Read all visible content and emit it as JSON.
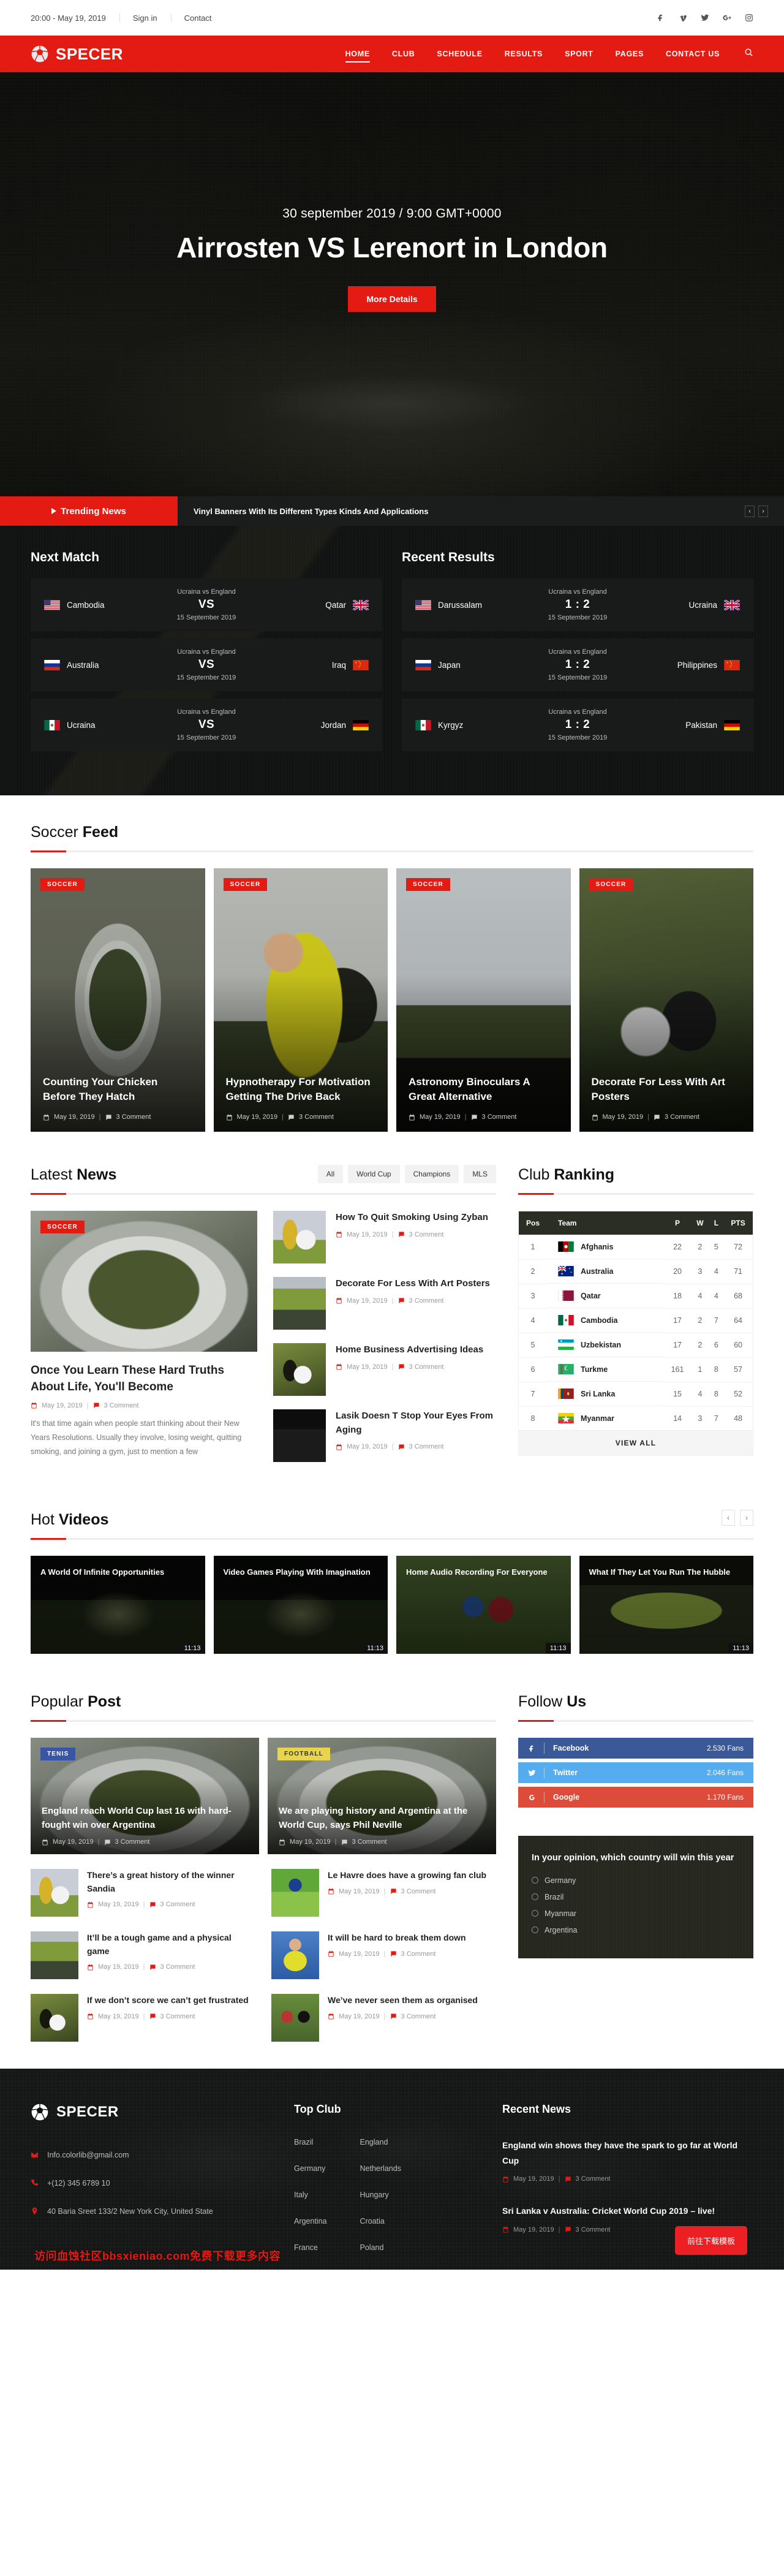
{
  "topbar": {
    "datetime": "20:00 - May 19, 2019",
    "signin": "Sign in",
    "contact": "Contact",
    "socials": [
      "facebook-icon",
      "vimeo-icon",
      "twitter-icon",
      "google-plus-icon",
      "instagram-icon"
    ]
  },
  "nav": {
    "brand": "SPECER",
    "items": [
      {
        "label": "HOME",
        "active": true
      },
      {
        "label": "CLUB",
        "active": false
      },
      {
        "label": "SCHEDULE",
        "active": false
      },
      {
        "label": "RESULTS",
        "active": false
      },
      {
        "label": "SPORT",
        "active": false
      },
      {
        "label": "PAGES",
        "active": false
      },
      {
        "label": "CONTACT US",
        "active": false
      }
    ],
    "search_icon": "search-icon"
  },
  "hero": {
    "date": "30 september 2019 / 9:00 GMT+0000",
    "title": "Airrosten VS Lerenort in London",
    "button": "More Details"
  },
  "trending": {
    "label": "Trending News",
    "headline": "Vinyl Banners With Its Different Types Kinds And Applications",
    "prev": "‹",
    "next": "›"
  },
  "next_match": {
    "title": "Next Match",
    "matches": [
      {
        "home": "Cambodia",
        "away": "Qatar",
        "sub": "Ucraina vs England",
        "score": "VS",
        "date": "15 September 2019",
        "home_flag": "usa",
        "away_flag": "uk"
      },
      {
        "home": "Australia",
        "away": "Iraq",
        "sub": "Ucraina vs England",
        "score": "VS",
        "date": "15 September 2019",
        "home_flag": "russia",
        "away_flag": "china"
      },
      {
        "home": "Ucraina",
        "away": "Jordan",
        "sub": "Ucraina vs England",
        "score": "VS",
        "date": "15 September 2019",
        "home_flag": "mexico",
        "away_flag": "germany"
      }
    ]
  },
  "recent_results": {
    "title": "Recent Results",
    "matches": [
      {
        "home": "Darussalam",
        "away": "Ucraina",
        "sub": "Ucraina vs England",
        "score": "1 : 2",
        "date": "15 September 2019",
        "home_flag": "usa",
        "away_flag": "uk"
      },
      {
        "home": "Japan",
        "away": "Philippines",
        "sub": "Ucraina vs England",
        "score": "1 : 2",
        "date": "15 September 2019",
        "home_flag": "russia",
        "away_flag": "china"
      },
      {
        "home": "Kyrgyz",
        "away": "Pakistan",
        "sub": "Ucraina vs England",
        "score": "1 : 2",
        "date": "15 September 2019",
        "home_flag": "mexico",
        "away_flag": "germany"
      }
    ]
  },
  "soccer_feed": {
    "title_light": "Soccer ",
    "title_bold": "Feed",
    "cards": [
      {
        "category": "SOCCER",
        "title": "Counting Your Chicken Before They Hatch",
        "date": "May 19, 2019",
        "comments": "3 Comment",
        "img": "ph-stadium-aerial"
      },
      {
        "category": "SOCCER",
        "title": "Hypnotherapy For Motivation Getting The Drive Back",
        "date": "May 19, 2019",
        "comments": "3 Comment",
        "img": "ph-keeper"
      },
      {
        "category": "SOCCER",
        "title": "Astronomy Binoculars A Great Alternative",
        "date": "May 19, 2019",
        "comments": "3 Comment",
        "img": "ph-roof"
      },
      {
        "category": "SOCCER",
        "title": "Decorate For Less With Art Posters",
        "date": "May 19, 2019",
        "comments": "3 Comment",
        "img": "ph-boot"
      }
    ]
  },
  "latest_news": {
    "title_light": "Latest ",
    "title_bold": "News",
    "filters": [
      "All",
      "World Cup",
      "Champions",
      "MLS"
    ],
    "feature": {
      "category": "SOCCER",
      "title": "Once You Learn These Hard Truths About Life, You'll Become",
      "date": "May 19, 2019",
      "comments": "3 Comment",
      "excerpt": "It's that time again when people start thinking about their New Years Resolutions. Usually they involve, losing weight, quitting smoking, and joining a gym, just to mention a few",
      "img": "ph-archstadium"
    },
    "items": [
      {
        "title": "How To Quit Smoking Using Zyban",
        "date": "May 19, 2019",
        "comments": "3 Comment",
        "img": "ph-trophy"
      },
      {
        "title": "Decorate For Less With Art Posters",
        "date": "May 19, 2019",
        "comments": "3 Comment",
        "img": "ph-bigstad"
      },
      {
        "title": "Home Business Advertising Ideas",
        "date": "May 19, 2019",
        "comments": "3 Comment",
        "img": "ph-feet"
      },
      {
        "title": "Lasik Doesn T Stop Your Eyes From Aging",
        "date": "May 19, 2019",
        "comments": "3 Comment",
        "img": "ph-scoreboard"
      }
    ]
  },
  "club_ranking": {
    "title_light": "Club ",
    "title_bold": "Ranking",
    "columns": [
      "Pos",
      "Team",
      "P",
      "W",
      "L",
      "PTS"
    ],
    "rows": [
      {
        "pos": "1",
        "team": "Afghanis",
        "p": "22",
        "w": "2",
        "l": "5",
        "pts": "72",
        "flag": "afghanistan"
      },
      {
        "pos": "2",
        "team": "Australia",
        "p": "20",
        "w": "3",
        "l": "4",
        "pts": "71",
        "flag": "australia"
      },
      {
        "pos": "3",
        "team": "Qatar",
        "p": "18",
        "w": "4",
        "l": "4",
        "pts": "68",
        "flag": "qatar"
      },
      {
        "pos": "4",
        "team": "Cambodia",
        "p": "17",
        "w": "2",
        "l": "7",
        "pts": "64",
        "flag": "mexico"
      },
      {
        "pos": "5",
        "team": "Uzbekistan",
        "p": "17",
        "w": "2",
        "l": "6",
        "pts": "60",
        "flag": "uzbekistan"
      },
      {
        "pos": "6",
        "team": "Turkme",
        "p": "161",
        "w": "1",
        "l": "8",
        "pts": "57",
        "flag": "turkmenistan"
      },
      {
        "pos": "7",
        "team": "Sri Lanka",
        "p": "15",
        "w": "4",
        "l": "8",
        "pts": "52",
        "flag": "srilanka"
      },
      {
        "pos": "8",
        "team": "Myanmar",
        "p": "14",
        "w": "3",
        "l": "7",
        "pts": "48",
        "flag": "myanmar"
      }
    ],
    "view_all": "VIEW ALL"
  },
  "hot_videos": {
    "title_light": "Hot ",
    "title_bold": "Videos",
    "prev": "‹",
    "next": "›",
    "items": [
      {
        "title": "A World Of Infinite Opportunities",
        "duration": "11:13",
        "img": "ph-nightfield"
      },
      {
        "title": "Video Games Playing With Imagination",
        "duration": "11:13",
        "img": "ph-nightfield"
      },
      {
        "title": "Home Audio Recording For Everyone",
        "duration": "11:13",
        "img": "ph-players"
      },
      {
        "title": "What If They Let You Run The Hubble",
        "duration": "11:13",
        "img": "ph-fans"
      }
    ]
  },
  "popular_post": {
    "title_light": "Popular ",
    "title_bold": "Post",
    "top": [
      {
        "category": "TENIS",
        "cat_class": "tenis",
        "title": "England reach World Cup last 16 with hard-fought win over Argentina",
        "date": "May 19, 2019",
        "comments": "3 Comment",
        "img": "ph-archstadium"
      },
      {
        "category": "FOOTBALL",
        "cat_class": "football",
        "title": "We are playing history and Argentina at the World Cup, says Phil Neville",
        "date": "May 19, 2019",
        "comments": "3 Comment",
        "img": "ph-archstadium"
      }
    ],
    "items": [
      {
        "title": "There’s a great history of the winner Sandia",
        "date": "May 19, 2019",
        "comments": "3 Comment",
        "img": "ph-trophy"
      },
      {
        "title": "Le Havre does have a growing fan club",
        "date": "May 19, 2019",
        "comments": "3 Comment",
        "img": "ph-jumper"
      },
      {
        "title": "It’ll be a tough game and a physical game",
        "date": "May 19, 2019",
        "comments": "3 Comment",
        "img": "ph-bigstad"
      },
      {
        "title": "It will be hard to break them down",
        "date": "May 19, 2019",
        "comments": "3 Comment",
        "img": "ph-yellow"
      },
      {
        "title": "If we don’t score we can’t get frustrated",
        "date": "May 19, 2019",
        "comments": "3 Comment",
        "img": "ph-feet"
      },
      {
        "title": "We’ve never seen them as organised",
        "date": "May 19, 2019",
        "comments": "3 Comment",
        "img": "ph-handshake"
      }
    ]
  },
  "follow_us": {
    "title_light": "Follow ",
    "title_bold": "Us",
    "socials": [
      {
        "name": "Facebook",
        "count": "2.530 Fans",
        "color": "#3b5998",
        "icon": "facebook-icon"
      },
      {
        "name": "Twitter",
        "count": "2.046 Fans",
        "color": "#55acee",
        "icon": "twitter-icon"
      },
      {
        "name": "Google",
        "count": "1.170 Fans",
        "color": "#dd4b39",
        "icon": "google-icon"
      }
    ],
    "poll": {
      "question": "In your opinion, which country will win this year",
      "options": [
        "Germany",
        "Brazil",
        "Myanmar",
        "Argentina"
      ]
    }
  },
  "footer": {
    "brand": "SPECER",
    "email": "Info.colorlib@gmail.com",
    "phone": "+(12) 345 6789 10",
    "address": "40 Baria Sreet 133/2 New York City, United State",
    "topclub_title": "Top Club",
    "clubs_col1": [
      "Brazil",
      "Germany",
      "Italy",
      "Argentina",
      "France"
    ],
    "clubs_col2": [
      "England",
      "Netherlands",
      "Hungary",
      "Croatia",
      "Poland"
    ],
    "recent_title": "Recent News",
    "recent": [
      {
        "title": "England win shows they have the spark to go far at World Cup",
        "date": "May 19, 2019",
        "comments": "3 Comment"
      },
      {
        "title": "Sri Lanka v Australia: Cricket World Cup 2019 – live!",
        "date": "May 19, 2019",
        "comments": "3 Comment"
      }
    ],
    "watermark": "访问血蚀社区bbsxieniao.com免费下载更多内容",
    "download_btn": "前往下载模板"
  },
  "colors": {
    "accent": "#e41b13",
    "dark": "#111212",
    "facebook": "#3b5998",
    "twitter": "#55acee",
    "google": "#dd4b39"
  }
}
